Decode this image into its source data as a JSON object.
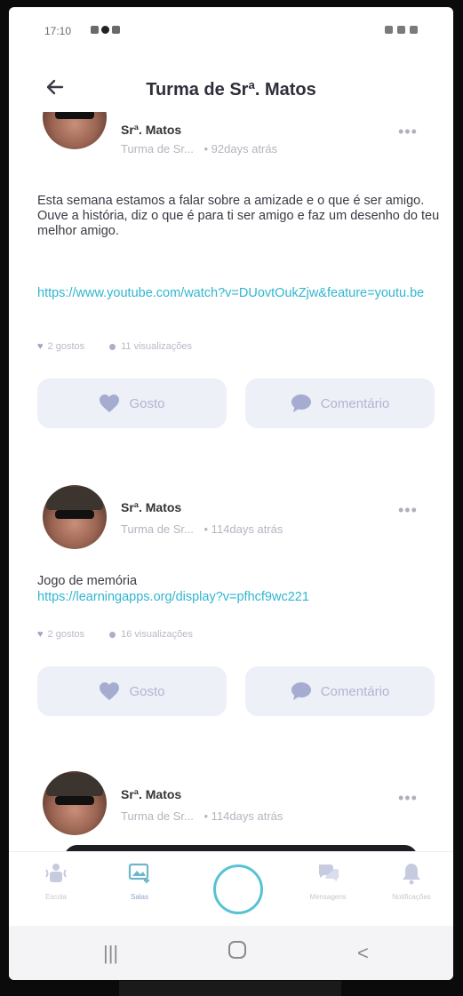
{
  "status_bar": {
    "time": "17:10"
  },
  "header": {
    "title": "Turma de Srª. Matos"
  },
  "posts": [
    {
      "author": "Srª. Matos",
      "group": "Turma de Sr...",
      "age": "• 92days atrás",
      "text": "Esta semana estamos a falar sobre a amizade e o que é ser amigo.\nOuve a história, diz o que é para ti ser amigo e faz um desenho do teu melhor amigo.",
      "link": "https://www.youtube.com/watch?v=DUovtOukZjw&feature=youtu.be",
      "likes": "2 gostos",
      "views": "11 visualizações",
      "like_label": "Gosto",
      "comment_label": "Comentário"
    },
    {
      "author": "Srª. Matos",
      "group": "Turma de Sr...",
      "age": "• 114days atrás",
      "text": "Jogo de memória",
      "link": "https://learningapps.org/display?v=pfhcf9wc221",
      "likes": "2 gostos",
      "views": "16 visualizações",
      "like_label": "Gosto",
      "comment_label": "Comentário"
    },
    {
      "author": "Srª. Matos",
      "group": "Turma de Sr...",
      "age": "• 114days atrás"
    }
  ],
  "bottom_nav": {
    "items": [
      {
        "label": "Escola",
        "icon": "school-icon"
      },
      {
        "label": "Salas",
        "icon": "rooms-icon"
      },
      {
        "label": "",
        "icon": "compose-circle-icon"
      },
      {
        "label": "Mensagens",
        "icon": "messages-icon"
      },
      {
        "label": "Notificações",
        "icon": "bell-icon"
      }
    ]
  },
  "colors": {
    "accent": "#31b6cf",
    "button_bg": "#eef0f8",
    "button_fg": "#b1b5d0"
  }
}
